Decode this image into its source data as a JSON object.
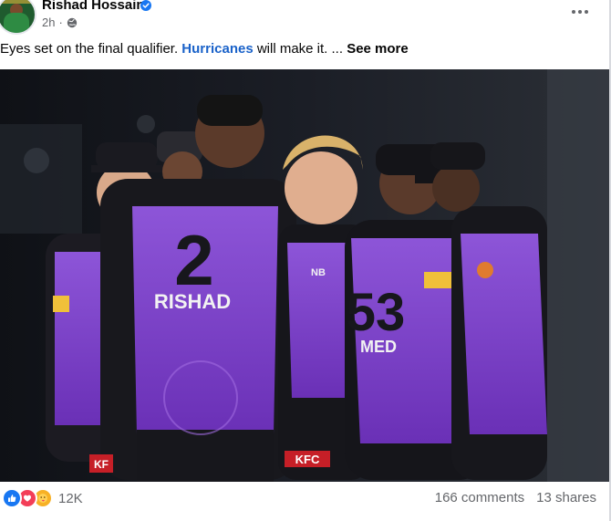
{
  "post": {
    "author": "Rishad Hossain",
    "time": "2h",
    "text_before": "Eyes set on the final qualifier. ",
    "tag": "Hurricanes",
    "text_after": "  will make it. ... ",
    "see_more": "See more"
  },
  "photo": {
    "jersey_number_front": "2",
    "jersey_name_front": "RISHAD",
    "jersey_number_right": "53",
    "jersey_name_right": "MED",
    "shorts_sponsor": "KFC",
    "shorts_sponsor_left": "KF",
    "brand_mark": "NB",
    "colors": {
      "jersey": "#7a3fc4",
      "jersey_light": "#a06ae0",
      "dark": "#17171c"
    }
  },
  "footer": {
    "reaction_count": "12K",
    "comments": "166 comments",
    "shares": "13 shares"
  },
  "colors": {
    "link": "#1a62c9",
    "like": "#1877f2",
    "love": "#f33e58",
    "care": "#f7b125",
    "muted": "#65676b"
  }
}
